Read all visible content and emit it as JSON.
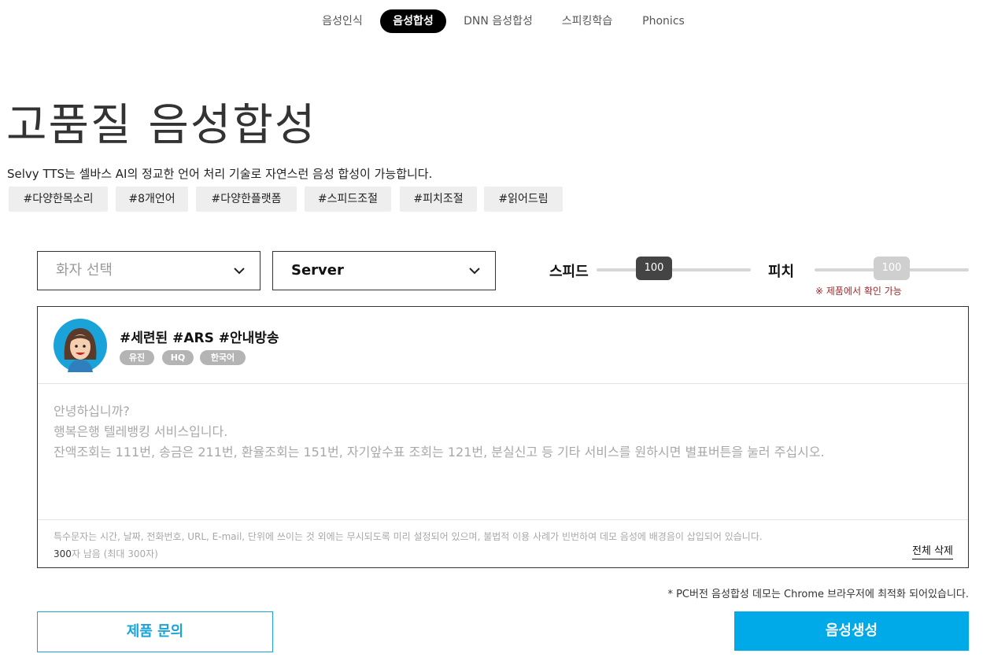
{
  "nav": {
    "tabs": [
      {
        "label": "음성인식",
        "active": false
      },
      {
        "label": "음성합성",
        "active": true
      },
      {
        "label": "DNN 음성합성",
        "active": false
      },
      {
        "label": "스피킹학습",
        "active": false
      },
      {
        "label": "Phonics",
        "active": false
      }
    ]
  },
  "hero": {
    "title": "고품질 음성합성",
    "subtitle": "Selvy TTS는 셀바스 AI의 정교한 언어 처리 기술로 자연스런 음성 합성이 가능합니다."
  },
  "tags": [
    "#다양한목소리",
    "#8개언어",
    "#다양한플랫폼",
    "#스피드조절",
    "#피치조절",
    "#읽어드림"
  ],
  "controls": {
    "speaker_select": {
      "value": "화자 선택",
      "icon": "chevron-down-icon"
    },
    "server_select": {
      "value": "Server",
      "icon": "chevron-down-icon"
    },
    "speed": {
      "label": "스피드",
      "value": "100",
      "position_fraction": 0.4
    },
    "pitch": {
      "label": "피치",
      "value": "100",
      "position_fraction": 0.5,
      "enabled": false
    },
    "pitch_note": "※ 제품에서 확인 가능"
  },
  "voice": {
    "title": "#세련된 #ARS #안내방송",
    "badges": [
      "유진",
      "HQ",
      "한국어"
    ],
    "avatar_icon": "woman-avatar-icon"
  },
  "editor": {
    "lines": [
      "안녕하십니까?",
      "행복은행 텔레뱅킹 서비스입니다.",
      "잔액조회는 111번, 송금은 211번, 환율조회는 151번, 자기앞수표 조회는 121번, 분실신고 등 기타 서비스를 원하시면 별표버튼을 눌러 주십시오."
    ],
    "notice": "특수문자는 시간, 날짜, 전화번호, URL, E-mail, 단위에 쓰이는 것 외에는 무시되도록 미리 설정되어 있으며, 불법적 이용 사례가 빈번하여 데모 음성에 배경음이 삽입되어 있습니다.",
    "count_num": "300",
    "count_text": "자 남음 (최대 300자)",
    "clear_label": "전체 삭제"
  },
  "footer": {
    "chrome_note": "* PC버전 음성합성 데모는 Chrome 브라우저에 최적화 되어있습니다.",
    "inquiry_label": "제품 문의",
    "generate_label": "음성생성"
  },
  "colors": {
    "accent": "#00a9e8",
    "active_tab": "#000000",
    "note_red": "#a0262a",
    "speed_thumb": "#444444",
    "pitch_thumb": "#cfcfcf"
  }
}
